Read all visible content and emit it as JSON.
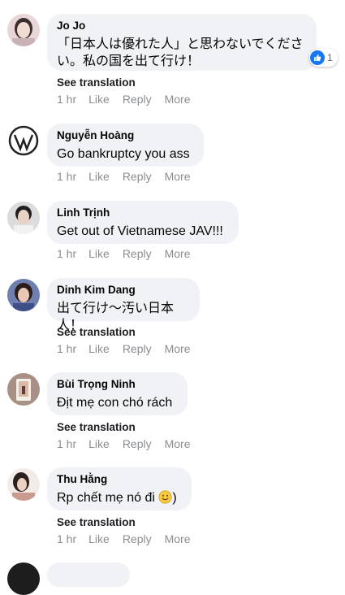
{
  "actions": {
    "see_translation": "See translation",
    "time": "1 hr",
    "like": "Like",
    "reply": "Reply",
    "more": "More"
  },
  "reaction": {
    "icon": "like-icon",
    "count": "1"
  },
  "comments": [
    {
      "author": "Jo Jo",
      "text": "「日本人は優れた人」と思わないでください。私の国を出て行け！",
      "has_translation": true
    },
    {
      "author": "Nguyễn Hoàng",
      "text": "Go bankruptcy you ass",
      "has_translation": false
    },
    {
      "author": "Linh Trịnh",
      "text": "Get out of Vietnamese JAV!!!",
      "has_translation": false
    },
    {
      "author": "Dinh Kim Dang",
      "text": "出て行け〜汚い日本人！",
      "has_translation": true
    },
    {
      "author": "Bùi Trọng Ninh",
      "text": "Địt mẹ con chó rách",
      "has_translation": true
    },
    {
      "author": "Thu Hằng",
      "text_before": "Rp chết mẹ nó đi ",
      "emoji": "smiling-face-emoji",
      "text_after": ")",
      "has_translation": true
    }
  ],
  "colors": {
    "bubble": "#f0f2f5",
    "meta": "#8a8d91",
    "like_blue": "#1877f2"
  }
}
